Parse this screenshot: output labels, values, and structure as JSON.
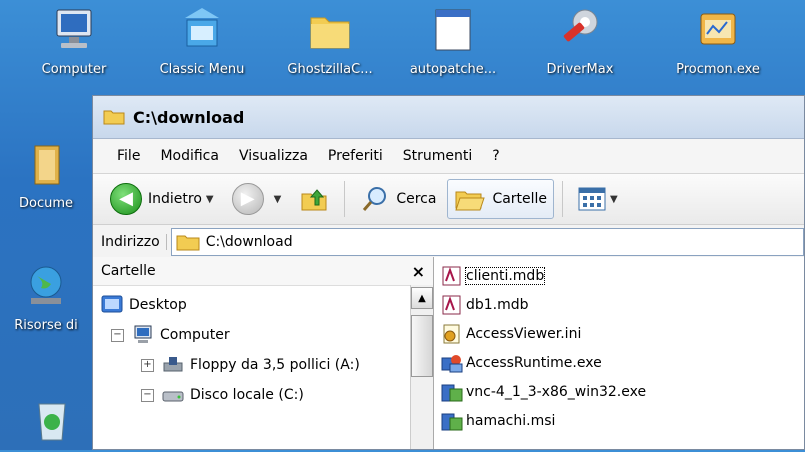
{
  "desktop": {
    "icons": [
      {
        "label": "Computer"
      },
      {
        "label": "Classic Menu"
      },
      {
        "label": "GhostzillaC..."
      },
      {
        "label": "autopatche..."
      },
      {
        "label": "DriverMax"
      },
      {
        "label": "Procmon.exe"
      },
      {
        "label": "Docume"
      },
      {
        "label": "Risorse di"
      }
    ]
  },
  "window": {
    "title": "C:\\download",
    "menu": [
      "File",
      "Modifica",
      "Visualizza",
      "Preferiti",
      "Strumenti",
      "?"
    ],
    "toolbar": {
      "back_label": "Indietro",
      "search_label": "Cerca",
      "folders_label": "Cartelle"
    },
    "address": {
      "label": "Indirizzo",
      "value": "C:\\download"
    },
    "folders_pane": {
      "title": "Cartelle",
      "close": "×",
      "tree": [
        {
          "label": "Desktop",
          "expander": ""
        },
        {
          "label": "Computer",
          "expander": "−"
        },
        {
          "label": "Floppy da 3,5 pollici (A:)",
          "expander": "+"
        },
        {
          "label": "Disco locale (C:)",
          "expander": "−"
        }
      ]
    },
    "files": [
      {
        "name": "clienti.mdb",
        "icon": "access-db-icon"
      },
      {
        "name": "db1.mdb",
        "icon": "access-db-icon"
      },
      {
        "name": "AccessViewer.ini",
        "icon": "config-file-icon"
      },
      {
        "name": "AccessRuntime.exe",
        "icon": "installer-icon"
      },
      {
        "name": "vnc-4_1_3-x86_win32.exe",
        "icon": "installer-icon"
      },
      {
        "name": "hamachi.msi",
        "icon": "installer-icon"
      }
    ]
  }
}
